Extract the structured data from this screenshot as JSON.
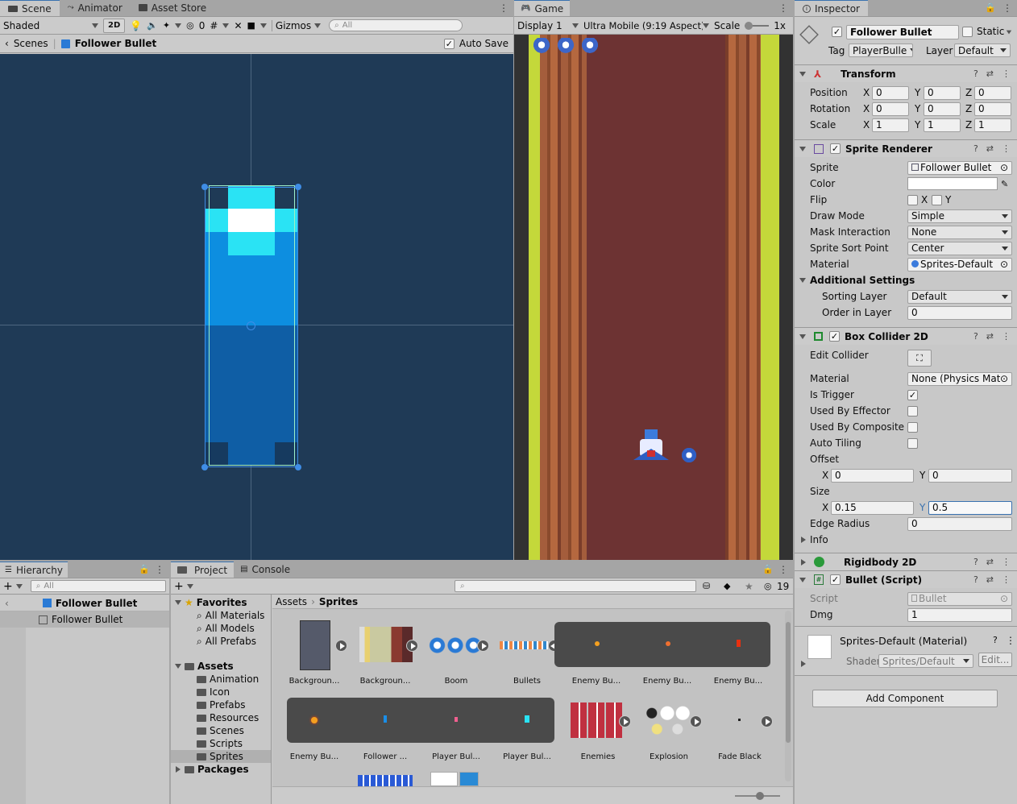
{
  "scene": {
    "tabs": [
      "Scene",
      "Animator",
      "Asset Store"
    ],
    "shading": "Shaded",
    "mode_2d": "2D",
    "hidden_count": "0",
    "gizmos": "Gizmos",
    "search_placeholder": "All",
    "breadcrumb_root": "Scenes",
    "breadcrumb_item": "Follower Bullet",
    "auto_save": "Auto Save",
    "bg_color": "#1f3a56"
  },
  "game": {
    "tab": "Game",
    "display": "Display 1",
    "aspect": "Ultra Mobile (9:19 Aspect)",
    "scale_label": "Scale",
    "scale_value": "1x"
  },
  "inspector": {
    "tab": "Inspector",
    "object_name": "Follower Bullet",
    "static_label": "Static",
    "tag_label": "Tag",
    "tag_value": "PlayerBulle",
    "layer_label": "Layer",
    "layer_value": "Default",
    "transform": {
      "title": "Transform",
      "position_label": "Position",
      "rotation_label": "Rotation",
      "scale_label": "Scale",
      "position": [
        "0",
        "0",
        "0"
      ],
      "rotation": [
        "0",
        "0",
        "0"
      ],
      "scale": [
        "1",
        "1",
        "1"
      ],
      "axes": [
        "X",
        "Y",
        "Z"
      ]
    },
    "sprite_renderer": {
      "title": "Sprite Renderer",
      "sprite_label": "Sprite",
      "sprite_value": "Follower Bullet",
      "color_label": "Color",
      "flip_label": "Flip",
      "flip_x": "X",
      "flip_y": "Y",
      "draw_mode_label": "Draw Mode",
      "draw_mode_value": "Simple",
      "mask_label": "Mask Interaction",
      "mask_value": "None",
      "sort_point_label": "Sprite Sort Point",
      "sort_point_value": "Center",
      "material_label": "Material",
      "material_value": "Sprites-Default",
      "additional_label": "Additional Settings",
      "sorting_layer_label": "Sorting Layer",
      "sorting_layer_value": "Default",
      "order_label": "Order in Layer",
      "order_value": "0"
    },
    "box_collider": {
      "title": "Box Collider 2D",
      "edit_label": "Edit Collider",
      "material_label": "Material",
      "material_value": "None (Physics Mate",
      "trigger_label": "Is Trigger",
      "effector_label": "Used By Effector",
      "composite_label": "Used By Composite",
      "tiling_label": "Auto Tiling",
      "offset_label": "Offset",
      "offset_x": "0",
      "offset_y": "0",
      "size_label": "Size",
      "size_x": "0.15",
      "size_y": "0.5",
      "edge_label": "Edge Radius",
      "edge_value": "0",
      "info_label": "Info"
    },
    "rigidbody": {
      "title": "Rigidbody 2D"
    },
    "bullet_script": {
      "title": "Bullet (Script)",
      "script_label": "Script",
      "script_value": "Bullet",
      "dmg_label": "Dmg",
      "dmg_value": "1"
    },
    "material": {
      "title": "Sprites-Default (Material)",
      "shader_label": "Shader",
      "shader_value": "Sprites/Default",
      "edit_button": "Edit..."
    },
    "add_component": "Add Component"
  },
  "hierarchy": {
    "tab": "Hierarchy",
    "search_placeholder": "All",
    "root": "Follower Bullet",
    "child": "Follower Bullet"
  },
  "project": {
    "tabs": [
      "Project",
      "Console"
    ],
    "hidden_count": "19",
    "favorites_label": "Favorites",
    "favorites": [
      "All Materials",
      "All Models",
      "All Prefabs"
    ],
    "assets_label": "Assets",
    "folders": [
      "Animation",
      "Icon",
      "Prefabs",
      "Resources",
      "Scenes",
      "Scripts",
      "Sprites"
    ],
    "packages_label": "Packages",
    "breadcrumb": [
      "Assets",
      "Sprites"
    ],
    "row1": [
      "Backgroun...",
      "Backgroun...",
      "Boom",
      "Bullets",
      "Enemy Bu...",
      "Enemy Bu...",
      "Enemy Bu..."
    ],
    "row2": [
      "Enemy Bu...",
      "Follower ...",
      "Player Bul...",
      "Player Bul...",
      "Enemies",
      "Explosion",
      "Fade Black"
    ]
  }
}
